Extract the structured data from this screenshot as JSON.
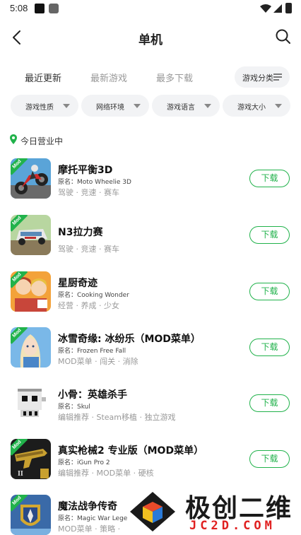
{
  "status_bar": {
    "time": "5:08"
  },
  "header": {
    "title": "单机"
  },
  "sort_tabs": [
    {
      "label": "最近更新",
      "active": true
    },
    {
      "label": "最新游戏",
      "active": false
    },
    {
      "label": "最多下载",
      "active": false
    }
  ],
  "category_button": {
    "label": "游戏分类"
  },
  "filters": [
    {
      "label": "游戏性质"
    },
    {
      "label": "网络环境"
    },
    {
      "label": "游戏语言"
    },
    {
      "label": "游戏大小"
    }
  ],
  "section": {
    "label": "今日营业中"
  },
  "games": [
    {
      "title": "摩托平衡3D",
      "original": "原名：Moto Wheelie 3D",
      "tags": "驾驶 · 竞速 · 赛车",
      "badge": "Mod",
      "button": "下载"
    },
    {
      "title": "N3拉力赛",
      "original": "",
      "tags": "驾驶 · 竞速 · 赛车",
      "badge": "Mod",
      "button": "下载"
    },
    {
      "title": "星厨奇迹",
      "original": "原名：Cooking Wonder",
      "tags": "经营 · 养成 · 少女",
      "badge": "Mod",
      "button": "下载"
    },
    {
      "title": "冰雪奇缘: 冰纷乐（MOD菜单）",
      "original": "原名：Frozen Free Fall",
      "tags": "MOD菜单 · 闯关 · 消除",
      "badge": "Mod",
      "button": "下载"
    },
    {
      "title": "小骨：英雄杀手",
      "original": "原名：Skul",
      "tags": "编辑推荐 · Steam移植 · 独立游戏",
      "badge": "",
      "button": "下载"
    },
    {
      "title": "真实枪械2 专业版（MOD菜单）",
      "original": "原名：iGun Pro 2",
      "tags": "编辑推荐 · MOD菜单 · 硬核",
      "badge": "Mod",
      "button": "下载"
    },
    {
      "title": "魔法战争传奇",
      "original": "原名：Magic War Lege",
      "tags": "MOD菜单 · 策略 · ",
      "badge": "Mod",
      "button": ""
    }
  ],
  "watermark": {
    "cn": "极创二维",
    "en": "JC2D.COM"
  },
  "colors": {
    "accent": "#21b24b",
    "chip_bg": "#f2f3f5",
    "watermark_red": "#e02020"
  }
}
